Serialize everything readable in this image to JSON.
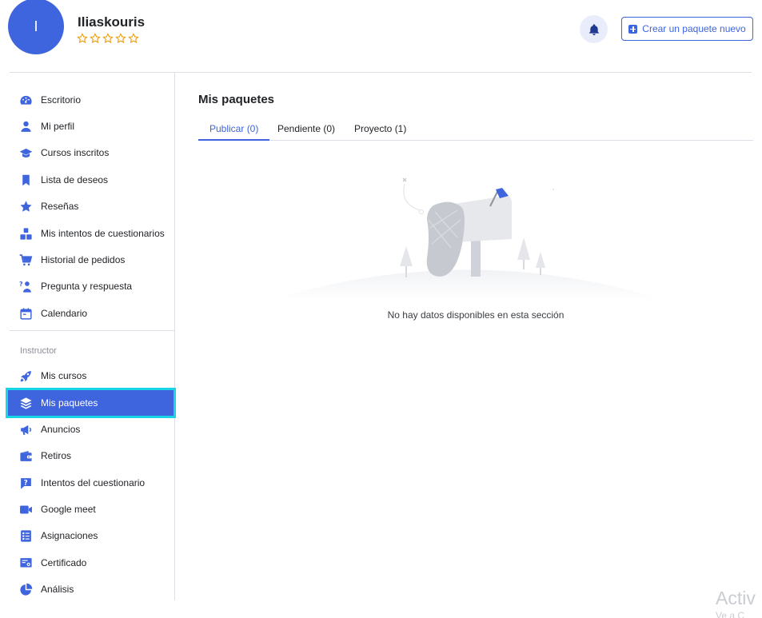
{
  "profile": {
    "avatar_initial": "I",
    "name": "Iliaskouris",
    "rating_stars": 0,
    "rating_max": 5
  },
  "header": {
    "create_button_label": "Crear un paquete nuevo"
  },
  "sidebar": {
    "items": [
      {
        "label": "Escritorio",
        "icon": "dashboard-icon"
      },
      {
        "label": "Mi perfil",
        "icon": "user-icon"
      },
      {
        "label": "Cursos inscritos",
        "icon": "graduation-cap-icon"
      },
      {
        "label": "Lista de deseos",
        "icon": "bookmark-icon"
      },
      {
        "label": "Reseñas",
        "icon": "star-icon"
      },
      {
        "label": "Mis intentos de cuestionarios",
        "icon": "quiz-attempts-icon"
      },
      {
        "label": "Historial de pedidos",
        "icon": "cart-icon"
      },
      {
        "label": "Pregunta y respuesta",
        "icon": "qa-icon"
      },
      {
        "label": "Calendario",
        "icon": "calendar-icon"
      }
    ],
    "section_label": "Instructor",
    "instructor_items": [
      {
        "label": "Mis cursos",
        "icon": "rocket-icon"
      },
      {
        "label": "Mis paquetes",
        "icon": "layers-icon",
        "active": true
      },
      {
        "label": "Anuncios",
        "icon": "megaphone-icon"
      },
      {
        "label": "Retiros",
        "icon": "wallet-icon"
      },
      {
        "label": "Intentos del cuestionario",
        "icon": "question-icon"
      },
      {
        "label": "Google meet",
        "icon": "video-camera-icon"
      },
      {
        "label": "Asignaciones",
        "icon": "assignment-icon"
      },
      {
        "label": "Certificado",
        "icon": "certificate-icon"
      },
      {
        "label": "Análisis",
        "icon": "pie-chart-icon"
      }
    ]
  },
  "main": {
    "title": "Mis paquetes",
    "tabs": [
      {
        "label": "Publicar (0)",
        "active": true
      },
      {
        "label": "Pendiente (0)"
      },
      {
        "label": "Proyecto (1)"
      }
    ],
    "empty_message": "No hay datos disponibles en esta sección"
  },
  "watermark": {
    "line1": "Activ",
    "line2": "Ve a C"
  },
  "colors": {
    "accent": "#3e64de",
    "highlight_outline": "#19d5e8",
    "star": "#ed9700"
  }
}
